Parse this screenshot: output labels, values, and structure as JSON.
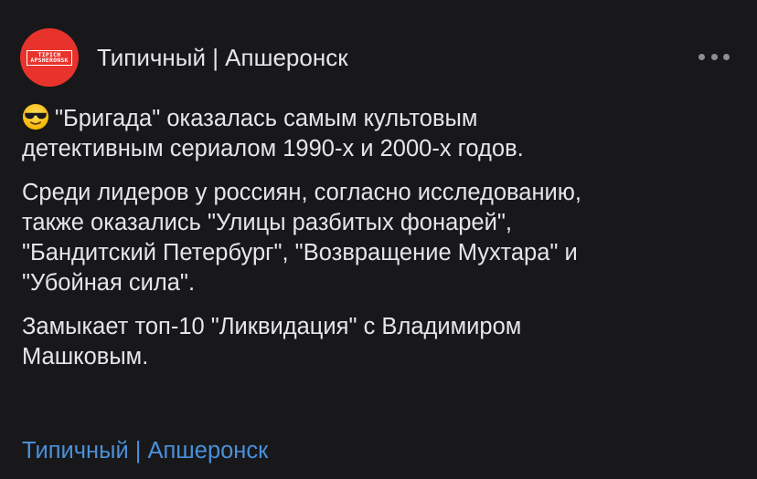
{
  "channel": {
    "name": "Типичный | Апшеронск",
    "avatar_line1": "TIPICH",
    "avatar_line2": "APSHERONSK",
    "avatar_color": "#e8332c"
  },
  "post": {
    "emoji": "smiling-face-with-sunglasses-icon",
    "p1_line1": "\"Бригада\" оказалась самым культовым",
    "p1_line2": "детективным сериалом 1990-х и 2000-х годов.",
    "p2_line1": "Среди лидеров у россиян, согласно исследованию,",
    "p2_line2": "также оказались \"Улицы разбитых фонарей\",",
    "p2_line3": "\"Бандитский Петербург\", \"Возвращение Мухтара\" и",
    "p2_line4": "\"Убойная сила\".",
    "p3_line1": "Замыкает топ-10 \"Ликвидация\" с Владимиром",
    "p3_line2": "Машковым.",
    "link_text": "Типичный | Апшеронск"
  },
  "colors": {
    "background": "#18181a",
    "text": "#e6e6e8",
    "link": "#4a90d9",
    "more_dots": "#8e8e93"
  },
  "icons": {
    "more": "more-horizontal-icon"
  }
}
